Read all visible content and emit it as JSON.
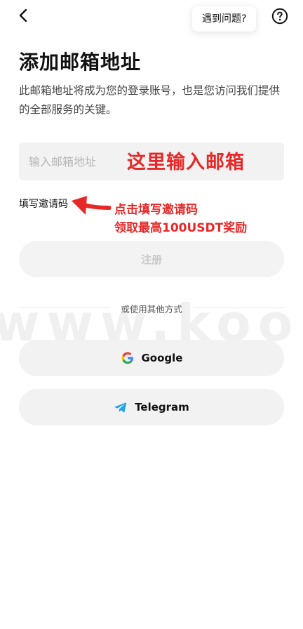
{
  "header": {
    "help_text": "遇到问题?"
  },
  "title": "添加邮箱地址",
  "subtitle": "此邮箱地址将成为您的登录账号，也是您访问我们提供的全部服务的关键。",
  "email": {
    "placeholder": "输入邮箱地址",
    "value": ""
  },
  "referral_link": "填写邀请码",
  "register_label": "注册",
  "divider_text": "或使用其他方式",
  "social": {
    "google_label": "Google",
    "telegram_label": "Telegram"
  },
  "annotations": {
    "email_hint": "这里输入邮箱",
    "referral_hint_line1": "点击填写邀请码",
    "referral_hint_line2": "领取最高100USDT奖励",
    "color": "#e82828"
  },
  "watermark": "www.koopuu.co",
  "icons": [
    "back-arrow-icon",
    "help-icon",
    "google-icon",
    "telegram-icon",
    "annotation-arrow"
  ],
  "colors": {
    "input_bg": "#f2f2f2",
    "button_disabled_text": "#c8c8c8",
    "telegram": "#2aa3e0"
  }
}
